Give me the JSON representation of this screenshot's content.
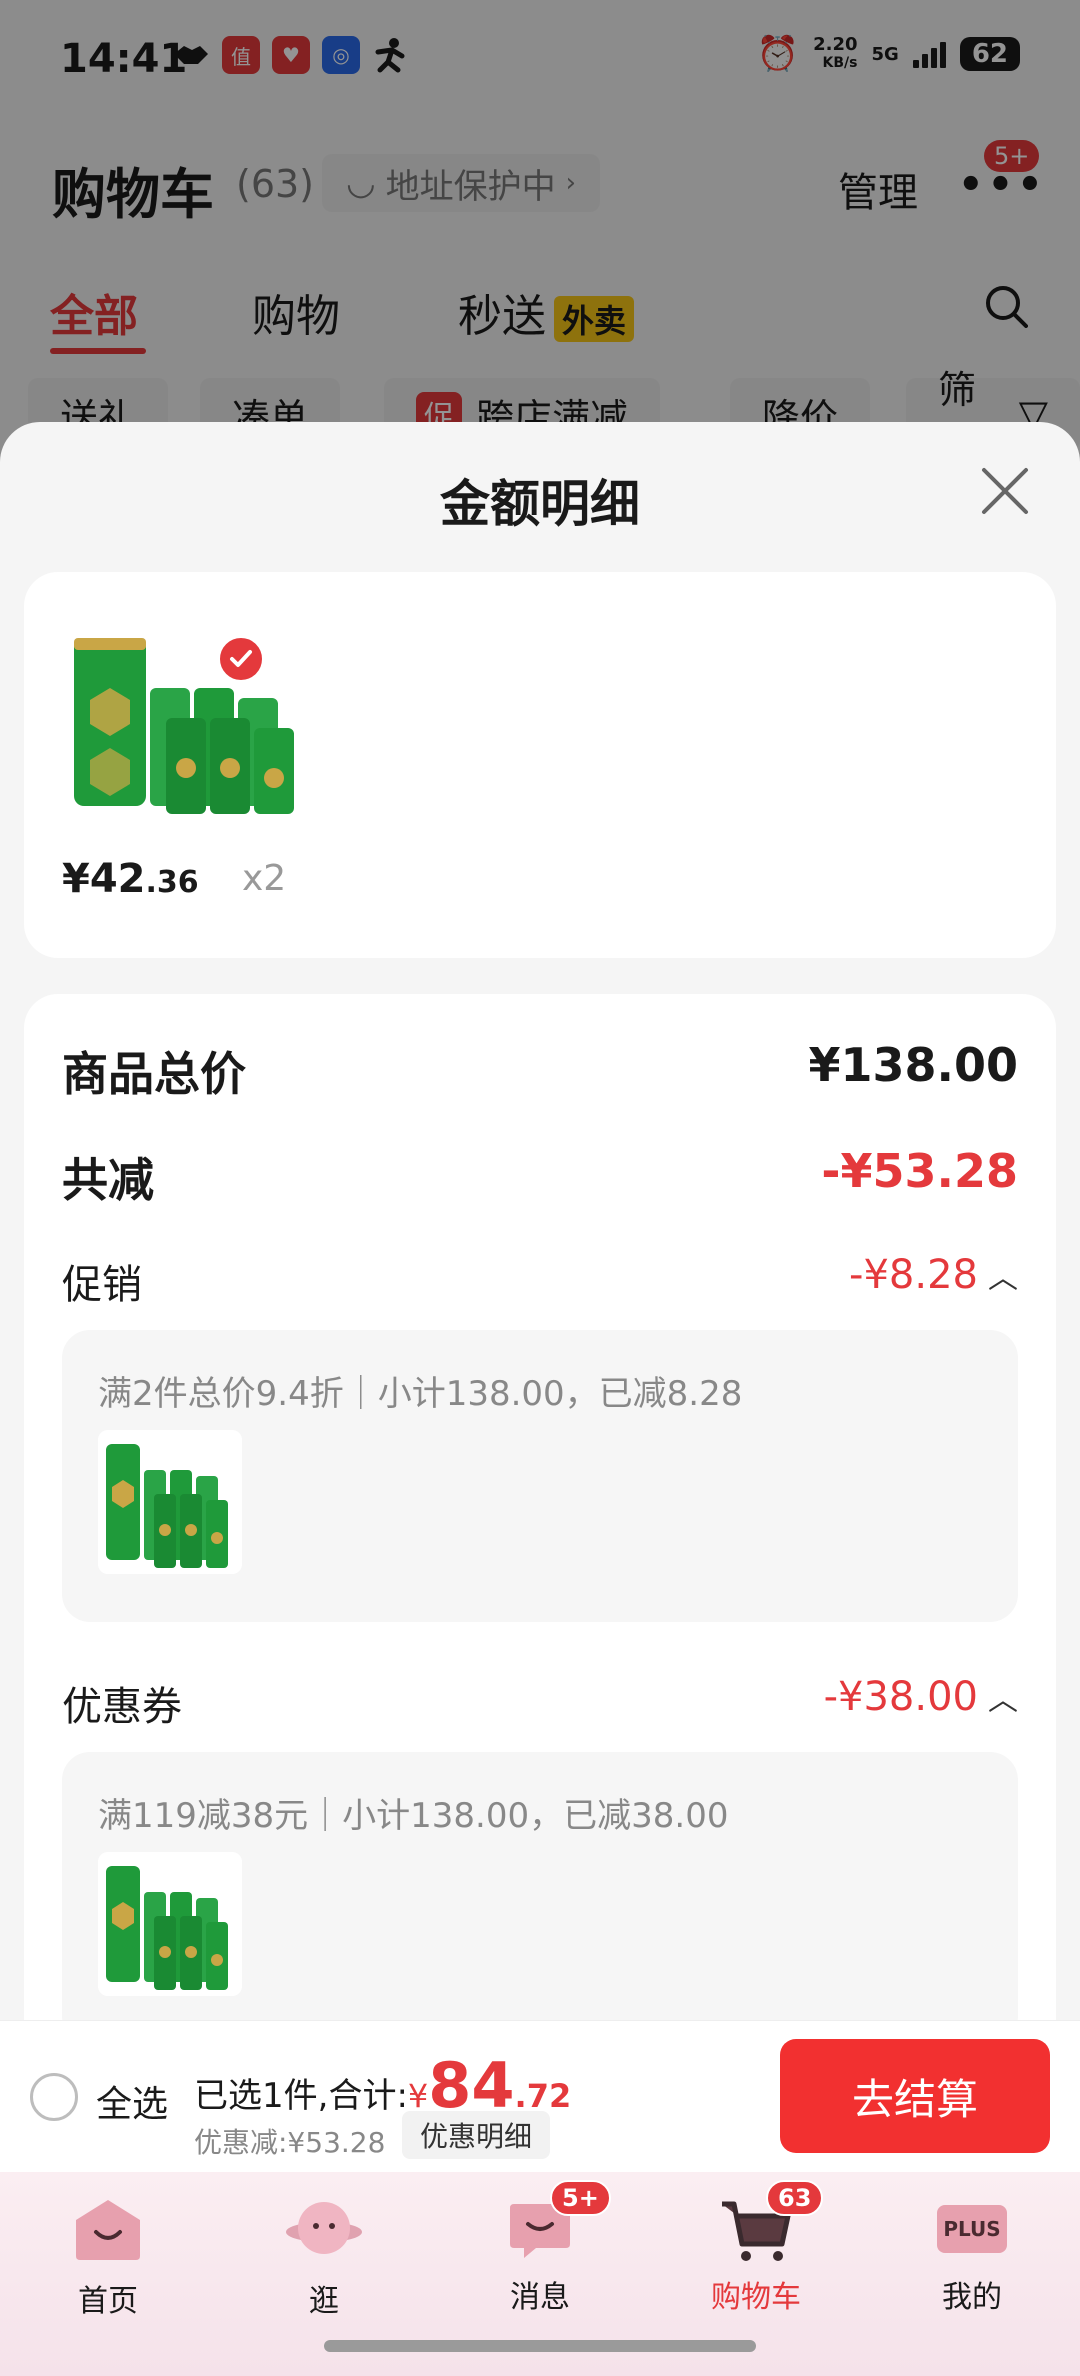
{
  "status_bar": {
    "time": "14:41",
    "net_speed": "2.20",
    "net_unit": "KB/s",
    "network": "5G",
    "battery": "62",
    "app_icons": [
      "handshake-icon",
      "jd-app-icon",
      "heart-app-icon",
      "nfc-app-icon",
      "runner-icon"
    ]
  },
  "header": {
    "title": "购物车",
    "count": "(63)",
    "address_label": "地址保护中",
    "manage_label": "管理",
    "more_badge": "5+"
  },
  "tabs": [
    {
      "label": "全部",
      "active": true
    },
    {
      "label": "购物",
      "active": false
    },
    {
      "label": "秒送",
      "active": false,
      "tag": "外卖"
    }
  ],
  "filters": [
    {
      "label": "送礼"
    },
    {
      "label": "凑单"
    },
    {
      "label": "跨店满减",
      "tag": "促"
    },
    {
      "label": "降价"
    },
    {
      "label": "筛选"
    }
  ],
  "sheet": {
    "title": "金额明细",
    "product": {
      "price_int": "¥42",
      "price_dec": ".36",
      "qty": "x2"
    },
    "total_label": "商品总价",
    "total_value": "¥138.00",
    "reduce_label": "共减",
    "reduce_value": "-¥53.28",
    "promo": {
      "label": "促销",
      "value": "-¥8.28",
      "desc": "满2件总价9.4折｜小计138.00，已减8.28"
    },
    "coupon": {
      "label": "优惠券",
      "value": "-¥38.00",
      "desc": "满119减38元｜小计138.00，已减38.00"
    }
  },
  "checkout": {
    "select_all": "全选",
    "selected_text": "已选1件,合计:",
    "currency": "¥",
    "amount_int": "84",
    "amount_dec": ".72",
    "discount_text": "优惠减:¥53.28",
    "detail_label": "优惠明细",
    "button_label": "去结算"
  },
  "nav": [
    {
      "label": "首页",
      "icon": "home-icon"
    },
    {
      "label": "逛",
      "icon": "planet-icon"
    },
    {
      "label": "消息",
      "icon": "message-icon",
      "badge": "5+"
    },
    {
      "label": "购物车",
      "icon": "cart-icon",
      "badge": "63",
      "active": true
    },
    {
      "label": "我的",
      "icon": "plus-icon",
      "text": "PLUS"
    }
  ],
  "colors": {
    "accent": "#e4393c",
    "checkout_button": "#f23030",
    "beer_green": "#1f9a3a",
    "gold": "#c9a646"
  }
}
